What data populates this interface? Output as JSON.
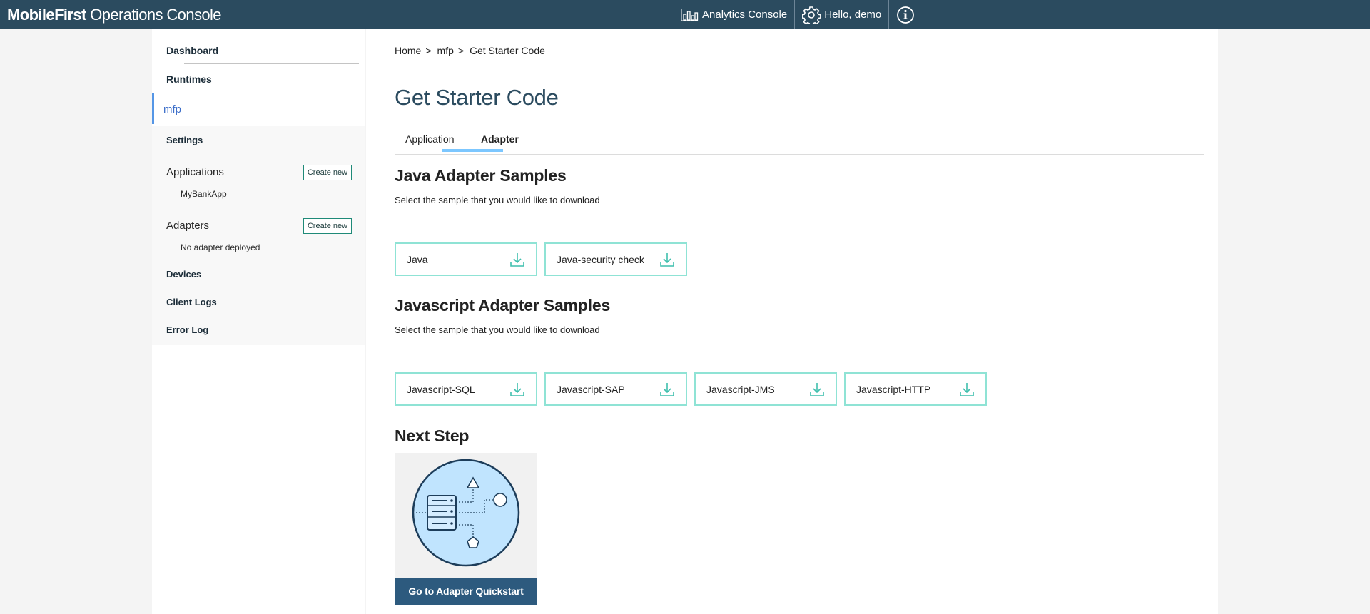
{
  "header": {
    "brand_bold": "MobileFirst",
    "brand_rest": " Operations Console",
    "analytics_label": "Analytics Console",
    "user_label": "Hello, demo",
    "icons": [
      "analytics-chart-icon",
      "gear-icon",
      "info-icon"
    ]
  },
  "sidebar": {
    "dashboard": "Dashboard",
    "runtimes": "Runtimes",
    "runtime_name": "mfp",
    "settings": "Settings",
    "applications": "Applications",
    "applications_create": "Create new",
    "app_item": "MyBankApp",
    "adapters": "Adapters",
    "adapters_create": "Create new",
    "adapter_item": "No adapter deployed",
    "devices": "Devices",
    "client_logs": "Client Logs",
    "error_log": "Error Log"
  },
  "breadcrumb": {
    "home": "Home",
    "runtime": "mfp",
    "current": "Get Starter Code",
    "separator": ">"
  },
  "page": {
    "title": "Get Starter Code",
    "tabs": [
      {
        "label": "Application",
        "active": false
      },
      {
        "label": "Adapter",
        "active": true
      }
    ]
  },
  "java_section": {
    "title": "Java Adapter Samples",
    "subtitle": "Select the sample that you would like to download",
    "samples": [
      "Java",
      "Java-security check"
    ]
  },
  "javascript_section": {
    "title": "Javascript Adapter Samples",
    "subtitle": "Select the sample that you would like to download",
    "samples": [
      "Javascript-SQL",
      "Javascript-SAP",
      "Javascript-JMS",
      "Javascript-HTTP"
    ]
  },
  "next_step": {
    "title": "Next Step",
    "button_label": "Go to Adapter Quickstart"
  },
  "colors": {
    "topbar": "#2b4b5f",
    "accent_blue": "#5596e6",
    "download_border": "#8fe3d5",
    "download_icon": "#3fbfad",
    "quickstart_button": "#2d5a7e"
  }
}
